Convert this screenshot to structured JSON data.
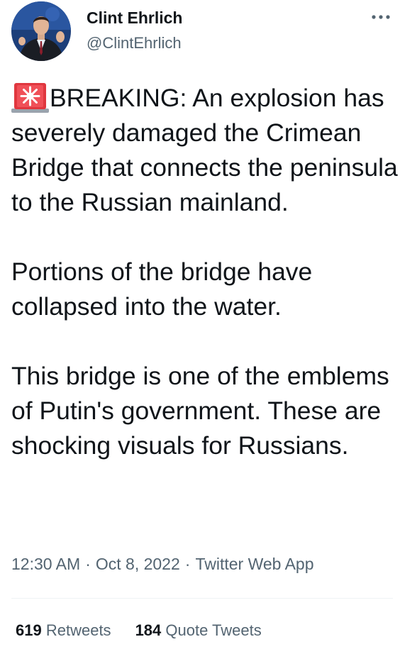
{
  "author": {
    "name": "Clint Ehrlich",
    "handle": "@ClintEhrlich",
    "avatar_icon": "profile-photo"
  },
  "more_icon": "more-options-icon",
  "tweet": {
    "emoji_icon": "rotating-light-siren-icon",
    "paragraphs": [
      "BREAKING: An explosion has severely damaged the Crimean Bridge that connects the peninsula to the Russian mainland.",
      "Portions of the bridge have collapsed into the water.",
      "This bridge is one of the emblems of Putin's government. These are shocking visuals for Russians."
    ]
  },
  "meta": {
    "time": "12:30 AM",
    "separator": "·",
    "date": "Oct 8, 2022",
    "source": "Twitter Web App"
  },
  "stats": {
    "retweets": {
      "count": "619",
      "label": "Retweets"
    },
    "quotes": {
      "count": "184",
      "label": "Quote Tweets"
    }
  },
  "colors": {
    "text_primary": "#0f1419",
    "text_secondary": "#536471",
    "divider": "#eff3f4",
    "siren_red": "#e0373f"
  }
}
